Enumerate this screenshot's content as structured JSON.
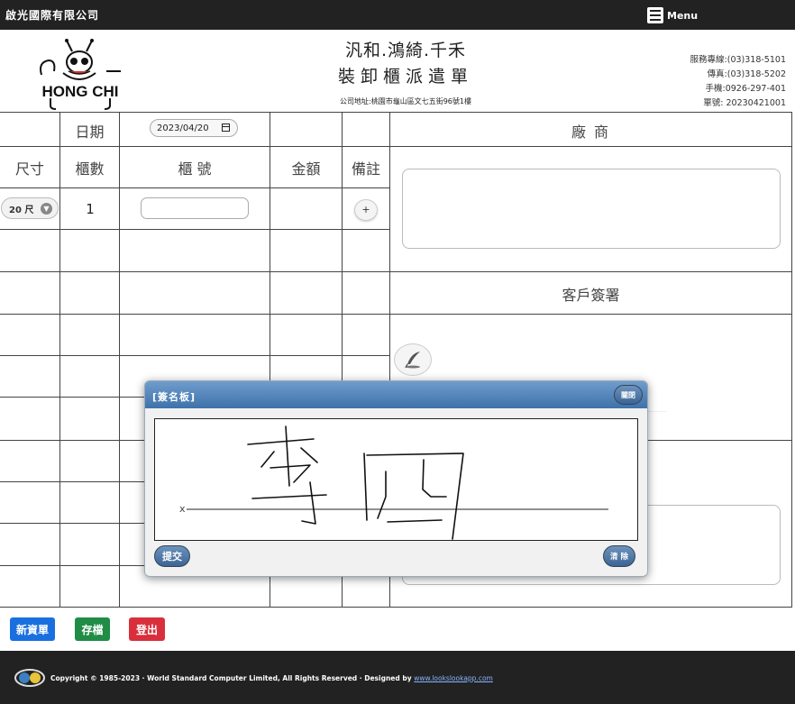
{
  "navbar": {
    "brand": "啟光國際有限公司",
    "menu_label": "Menu"
  },
  "header": {
    "logo_text": "HONG CHI",
    "company_names": "汎和.鴻綺.千禾",
    "document_title": "裝卸櫃派遣單",
    "address": "公司地址:桃園市龜山區文七五街96號1樓",
    "contact": {
      "service_line": "服務專線:(03)318-5101",
      "fax": "傳真:(03)318-5202",
      "mobile": "手機:0926-297-401",
      "order_no": "單號: 20230421001"
    }
  },
  "table": {
    "date_label": "日期",
    "date_value": "2023/04/20",
    "vendor_header": "廠 商",
    "col_size": "尺寸",
    "col_count": "櫃數",
    "col_box_no": "櫃 號",
    "col_amount": "金額",
    "col_remark": "備註",
    "row1": {
      "size": "20 尺",
      "count": "1",
      "add_label": "+"
    },
    "customer_signature_header": "客戶簽署"
  },
  "actions": {
    "new": "新資單",
    "save": "存檔",
    "logout": "登出"
  },
  "footer": {
    "copyright": "Copyright © 1985-2023 · World Standard Computer Limited, All Rights Reserved · Designed by ",
    "link_text": "www.lookslookapp.com"
  },
  "signature_dialog": {
    "title": "[簽名板]",
    "close_label": "關閉",
    "x_marker": "x",
    "submit_label": "提交",
    "clear_label": "清 除"
  },
  "colors": {
    "navbar_bg": "#222222",
    "btn_new": "#1a6fe0",
    "btn_save": "#208c46",
    "btn_logout": "#d92f3c",
    "dialog_header": "#4f80b5"
  }
}
